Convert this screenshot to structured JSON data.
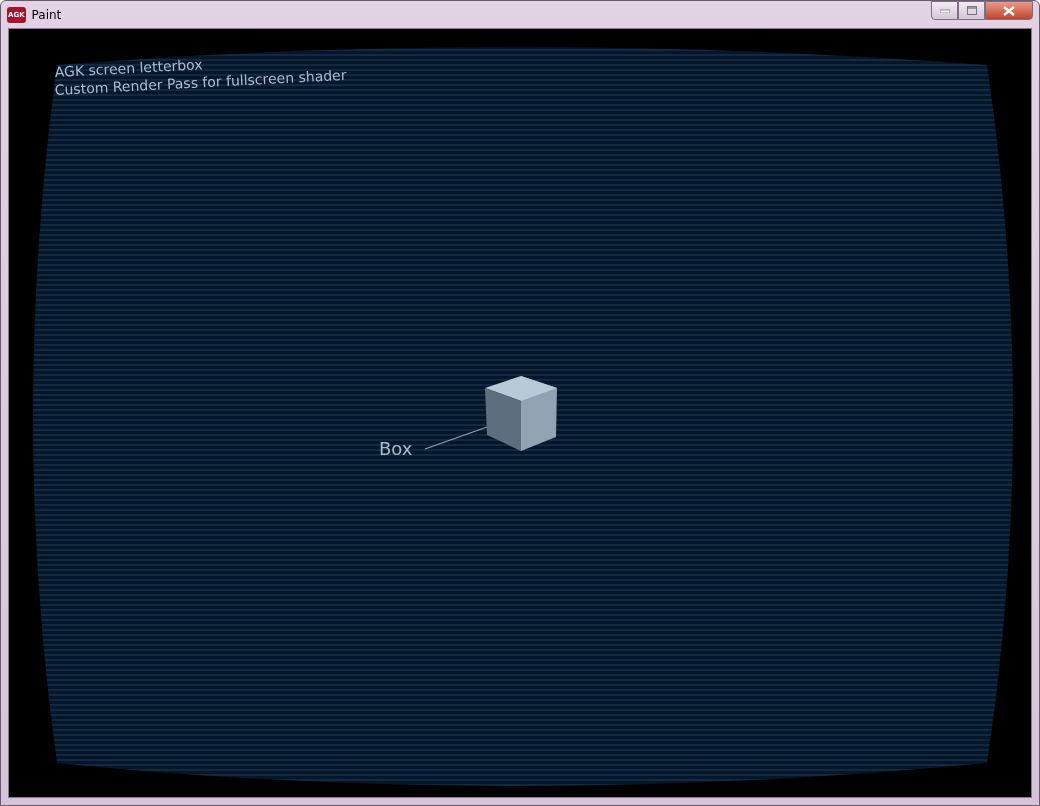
{
  "window": {
    "title": "Paint",
    "icon_text": "AGK"
  },
  "screen": {
    "overlay_lines": [
      "AGK screen letterbox",
      "Custom Render Pass for fullscreen shader"
    ],
    "object_label": "Box"
  }
}
